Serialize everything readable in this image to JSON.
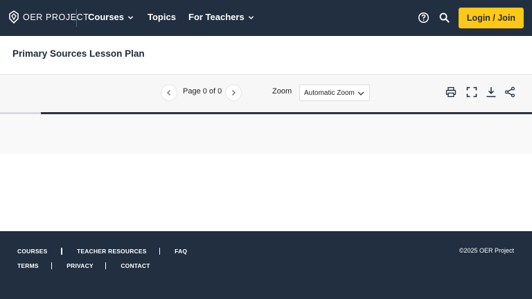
{
  "header": {
    "logo_text": "OER PROJECT",
    "nav": [
      {
        "label": "Courses",
        "has_dropdown": true
      },
      {
        "label": "Topics",
        "has_dropdown": false
      },
      {
        "label": "For Teachers",
        "has_dropdown": true
      }
    ],
    "icons": [
      "help-icon",
      "search-icon"
    ],
    "login_label": "Login / Join",
    "accent_color": "#ffc814",
    "background_color": "#212f41"
  },
  "page": {
    "title": "Primary Sources Lesson Plan"
  },
  "viewer": {
    "page_indicator": "Page 0 of 0",
    "zoom_label": "Zoom",
    "zoom_value": "Automatic Zoom",
    "tools": [
      "print-icon",
      "fullscreen-icon",
      "download-icon",
      "share-icon"
    ]
  },
  "footer": {
    "row1": [
      "COURSES",
      "TEACHER RESOURCES",
      "FAQ"
    ],
    "row2": [
      "TERMS",
      "PRIVACY",
      "CONTACT"
    ],
    "copyright": "©2025 OER Project"
  }
}
